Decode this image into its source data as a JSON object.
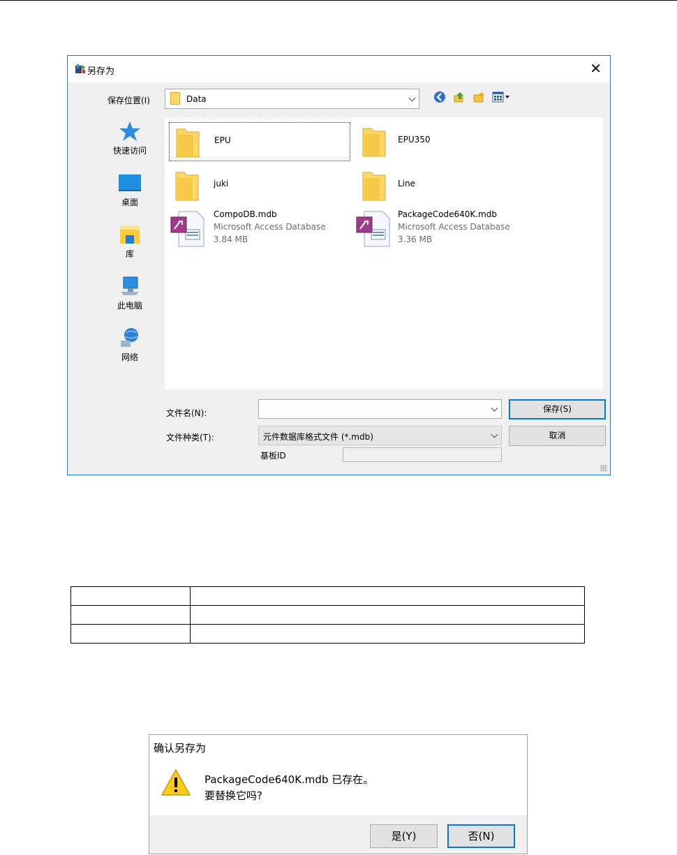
{
  "save_dialog": {
    "title": "另存为",
    "save_in_label": "保存位置(I)",
    "location": "Data",
    "places": [
      {
        "label": "快速访问",
        "icon": "quick-access-star-icon"
      },
      {
        "label": "桌面",
        "icon": "desktop-icon"
      },
      {
        "label": "库",
        "icon": "libraries-icon"
      },
      {
        "label": "此电脑",
        "icon": "this-pc-icon"
      },
      {
        "label": "网络",
        "icon": "network-icon"
      }
    ],
    "files": [
      {
        "name": "EPU",
        "type": "folder",
        "selected": true
      },
      {
        "name": "EPU350",
        "type": "folder"
      },
      {
        "name": "juki",
        "type": "folder"
      },
      {
        "name": "Line",
        "type": "folder"
      },
      {
        "name": "CompoDB.mdb",
        "type_text": "Microsoft Access Database",
        "size": "3.84 MB"
      },
      {
        "name": "PackageCode640K.mdb",
        "type_text": "Microsoft Access Database",
        "size": "3.36 MB"
      }
    ],
    "filename_label": "文件名(N):",
    "filename_value": "",
    "filetype_label": "文件种类(T):",
    "filetype_value": "元件数据库格式文件 (*.mdb)",
    "board_id_label": "基板ID",
    "board_id_value": "",
    "save_button": "保存(S)",
    "cancel_button": "取消"
  },
  "blank_table": {
    "rows": [
      [
        "",
        ""
      ],
      [
        "",
        ""
      ],
      [
        "",
        ""
      ]
    ]
  },
  "confirm_dialog": {
    "title": "确认另存为",
    "message_line1": "PackageCode640K.mdb 已存在。",
    "message_line2": "要替换它吗?",
    "yes_button": "是(Y)",
    "no_button": "否(N)"
  },
  "colors": {
    "accent": "#0078d7",
    "folder": "#ffd866",
    "dialog_bg": "#f0f0f0"
  }
}
